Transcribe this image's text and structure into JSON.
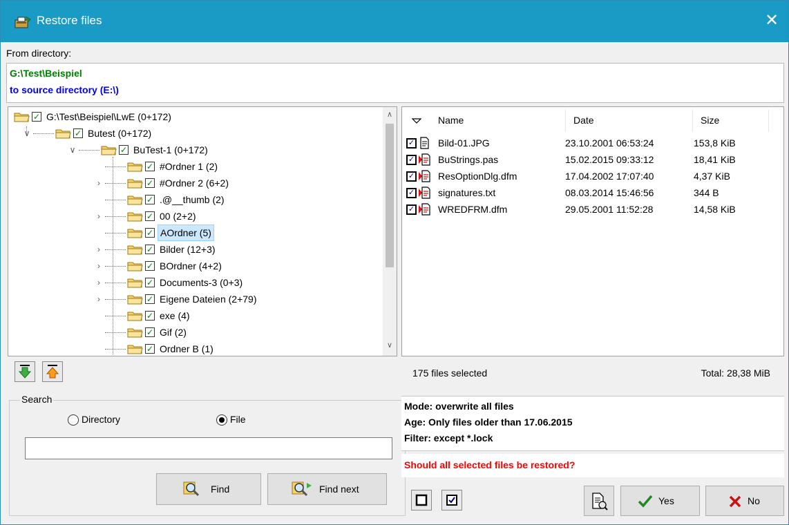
{
  "window": {
    "title": "Restore files",
    "close_glyph": "✕"
  },
  "from": {
    "label": "From directory:",
    "directory": "G:\\Test\\Beispiel",
    "source": "to source directory (E:\\)"
  },
  "tree": {
    "items": [
      {
        "label": "G:\\Test\\Beispiel\\LwE (0+172)",
        "expander": ""
      },
      {
        "label": "Butest (0+172)",
        "expander": "expanded"
      },
      {
        "label": "BuTest-1 (0+172)",
        "expander": "expanded"
      },
      {
        "label": "#Ordner 1 (2)",
        "expander": ""
      },
      {
        "label": "#Ordner 2 (6+2)",
        "expander": "collapsed"
      },
      {
        "label": ".@__thumb (2)",
        "expander": ""
      },
      {
        "label": "00 (2+2)",
        "expander": "collapsed"
      },
      {
        "label": "AOrdner (5)",
        "expander": "",
        "selected": true
      },
      {
        "label": "Bilder (12+3)",
        "expander": "collapsed"
      },
      {
        "label": "BOrdner (4+2)",
        "expander": "collapsed"
      },
      {
        "label": "Documents-3 (0+3)",
        "expander": "collapsed"
      },
      {
        "label": "Eigene Dateien (2+79)",
        "expander": "collapsed"
      },
      {
        "label": "exe (4)",
        "expander": ""
      },
      {
        "label": "Gif (2)",
        "expander": ""
      },
      {
        "label": "Ordner B (1)",
        "expander": ""
      }
    ]
  },
  "files": {
    "columns": {
      "name": "Name",
      "date": "Date",
      "size": "Size"
    },
    "rows": [
      {
        "name": "Bild-01.JPG",
        "date": "23.10.2001 06:53:24",
        "size": "153,8 KiB",
        "icon": "document-icon"
      },
      {
        "name": "BuStrings.pas",
        "date": "15.02.2015 09:33:12",
        "size": "18,41 KiB",
        "icon": "document-conflict-icon"
      },
      {
        "name": "ResOptionDlg.dfm",
        "date": "17.04.2002 17:07:40",
        "size": "4,37 KiB",
        "icon": "document-conflict-icon"
      },
      {
        "name": "signatures.txt",
        "date": "08.03.2014 15:46:56",
        "size": "344 B",
        "icon": "document-conflict-icon"
      },
      {
        "name": "WREDFRM.dfm",
        "date": "29.05.2001 11:52:28",
        "size": "14,58 KiB",
        "icon": "document-conflict-icon"
      }
    ]
  },
  "status": {
    "selected": "175 files selected",
    "total": "Total: 28,38 MiB"
  },
  "info": {
    "mode": "Mode: overwrite all files",
    "age": "Age: Only files older than 17.06.2015",
    "filter": "Filter: except *.lock",
    "question": "Should all selected files be restored?"
  },
  "search": {
    "legend": "Search",
    "directory_label": "Directory",
    "file_label": "File",
    "selected": "File",
    "value": "",
    "find_label": "Find",
    "find_next_label": "Find next"
  },
  "buttons": {
    "yes": "Yes",
    "no": "No"
  },
  "colors": {
    "titlebar": "#1a9bc6",
    "directory": "#008000",
    "source": "#0000e6",
    "question": "#ff0000"
  }
}
